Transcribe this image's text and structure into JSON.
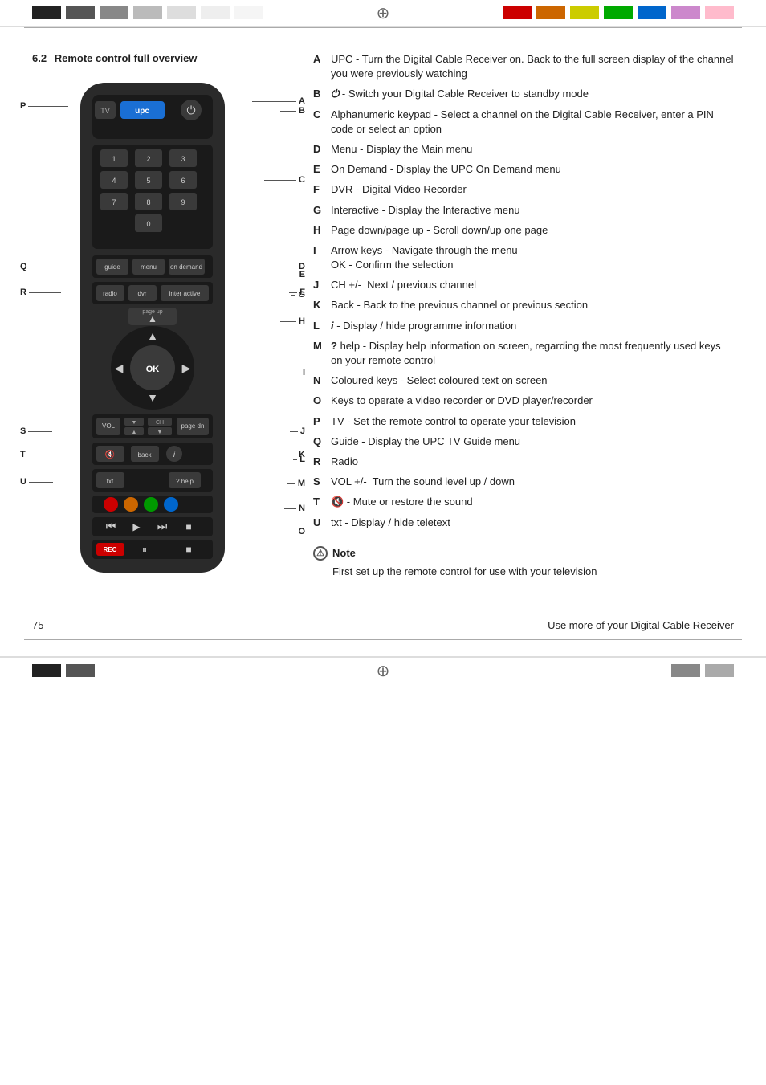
{
  "header": {
    "colorStripsLeft": [
      "#1a1a1a",
      "#4a4a4a",
      "#7a7a7a",
      "#aaaaaa",
      "#d0d0d0",
      "#e8e8e8",
      "#f5f5f5"
    ],
    "colorStripsRight": [
      "#cc0000",
      "#cc6600",
      "#cccc00",
      "#00aa00",
      "#0066cc",
      "#9900cc",
      "#ffaacc"
    ],
    "crosshair": "⊕"
  },
  "section": {
    "number": "6.2",
    "title": "Remote control full overview"
  },
  "descriptions": [
    {
      "letter": "A",
      "text": "UPC - Turn the Digital Cable Receiver on. Back to the full screen display of the channel you were previously watching"
    },
    {
      "letter": "B",
      "text": "⏻ - Switch your Digital Cable Receiver to standby mode"
    },
    {
      "letter": "C",
      "text": "Alphanumeric keypad - Select a channel on the Digital Cable Receiver, enter a PIN code or select an option"
    },
    {
      "letter": "D",
      "text": "Menu - Display the Main menu"
    },
    {
      "letter": "E",
      "text": "On Demand - Display the UPC On Demand menu"
    },
    {
      "letter": "F",
      "text": "DVR - Digital Video Recorder"
    },
    {
      "letter": "G",
      "text": "Interactive - Display the Interactive menu"
    },
    {
      "letter": "H",
      "text": "Page down/page up - Scroll down/up one page"
    },
    {
      "letter": "I",
      "text": "Arrow keys - Navigate through the menu OK - Confirm the selection"
    },
    {
      "letter": "J",
      "text": "CH +/-  Next / previous channel"
    },
    {
      "letter": "K",
      "text": "Back - Back to the previous channel or previous section"
    },
    {
      "letter": "L",
      "text": "ℹ - Display / hide programme information"
    },
    {
      "letter": "M",
      "text": "? help - Display help information on screen, regarding the most frequently used keys on your remote control"
    },
    {
      "letter": "N",
      "text": "Coloured keys - Select coloured text on screen"
    },
    {
      "letter": "O",
      "text": "Keys to operate a video recorder or DVD player/recorder"
    },
    {
      "letter": "P",
      "text": "TV - Set the remote control to operate your television"
    },
    {
      "letter": "Q",
      "text": "Guide - Display the UPC TV Guide menu"
    },
    {
      "letter": "R",
      "text": "Radio"
    },
    {
      "letter": "S",
      "text": "VOL +/-  Turn the sound level up / down"
    },
    {
      "letter": "T",
      "text": "🔇 - Mute or restore the sound"
    },
    {
      "letter": "U",
      "text": "txt - Display / hide teletext"
    }
  ],
  "note": {
    "label": "Note",
    "text": "First set up the remote control for use with your television"
  },
  "footer": {
    "pageNumber": "75",
    "text": "Use more of your Digital Cable Receiver"
  },
  "labels": {
    "A": "A",
    "B": "B",
    "C": "C",
    "D": "D",
    "E": "E",
    "F": "F",
    "G": "G",
    "H": "H",
    "I": "I",
    "J": "J",
    "K": "K",
    "L": "L",
    "M": "M",
    "N": "N",
    "O": "O",
    "P": "P",
    "Q": "Q",
    "R": "R",
    "S": "S",
    "T": "T",
    "U": "U"
  }
}
